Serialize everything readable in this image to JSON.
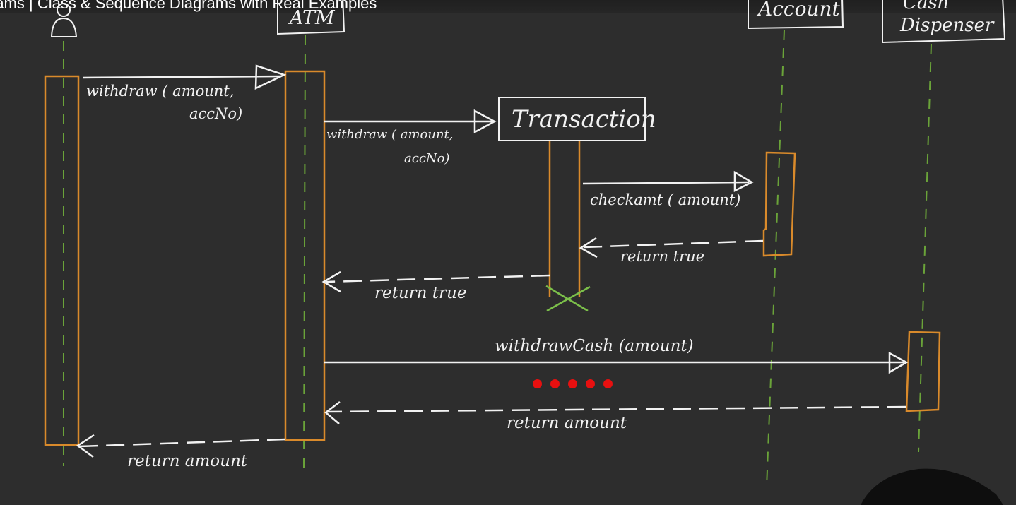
{
  "video": {
    "title": "rams | Class & Sequence Diagrams with Real Examples"
  },
  "diagram": {
    "participants": {
      "atm": "ATM",
      "account": "Account",
      "cash_dispenser_line1": "Cash",
      "cash_dispenser_line2": "Dispenser",
      "transaction": "Transaction"
    },
    "messages": {
      "m1_line1": "withdraw ( amount,",
      "m1_line2": "accNo)",
      "m2_line1": "withdraw ( amount,",
      "m2_line2": "accNo)",
      "m3": "checkamt ( amount)",
      "m4": "return true",
      "m5": "return true",
      "m6": "withdrawCash (amount)",
      "m7": "return amount",
      "m8": "return amount"
    }
  },
  "colors": {
    "background": "#2d2d2d",
    "chalk": "#f2f2f2",
    "activation": "#d98a2b",
    "lifeline": "#6aa339",
    "destroy": "#7cc04a",
    "dot": "#e81010"
  },
  "overlay": {
    "dots": 5
  }
}
